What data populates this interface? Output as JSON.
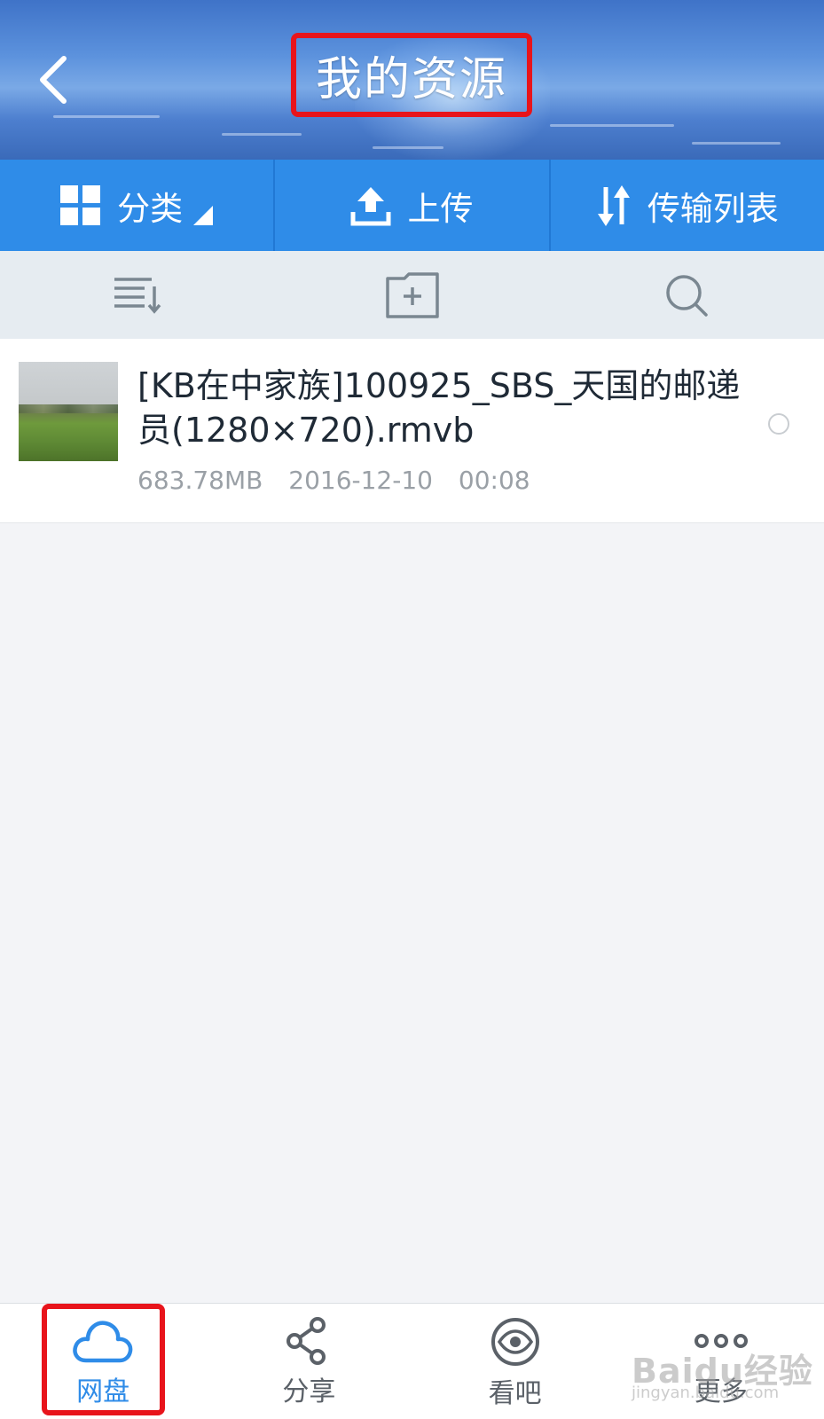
{
  "header": {
    "title": "我的资源",
    "back_icon": "chevron-left-icon"
  },
  "toolbar": {
    "category_label": "分类",
    "upload_label": "上传",
    "transfer_label": "传输列表"
  },
  "actions": {
    "sort_icon": "sort-list-icon",
    "new_folder_icon": "new-folder-icon",
    "search_icon": "search-icon"
  },
  "files": [
    {
      "name": "[KB在中家族]100925_SBS_天国的邮递员(1280×720).rmvb",
      "size": "683.78MB",
      "date": "2016-12-10",
      "time": "00:08"
    }
  ],
  "bottom_nav": {
    "items": [
      {
        "label": "网盘",
        "icon": "cloud-icon",
        "active": true
      },
      {
        "label": "分享",
        "icon": "share-icon",
        "active": false
      },
      {
        "label": "看吧",
        "icon": "eye-icon",
        "active": false
      },
      {
        "label": "更多",
        "icon": "more-icon",
        "active": false
      }
    ]
  },
  "watermark": {
    "brand": "Baidu经验",
    "url": "jingyan.baidu.com"
  },
  "colors": {
    "accent": "#2f8ce8",
    "highlight_box": "#e8141b"
  }
}
